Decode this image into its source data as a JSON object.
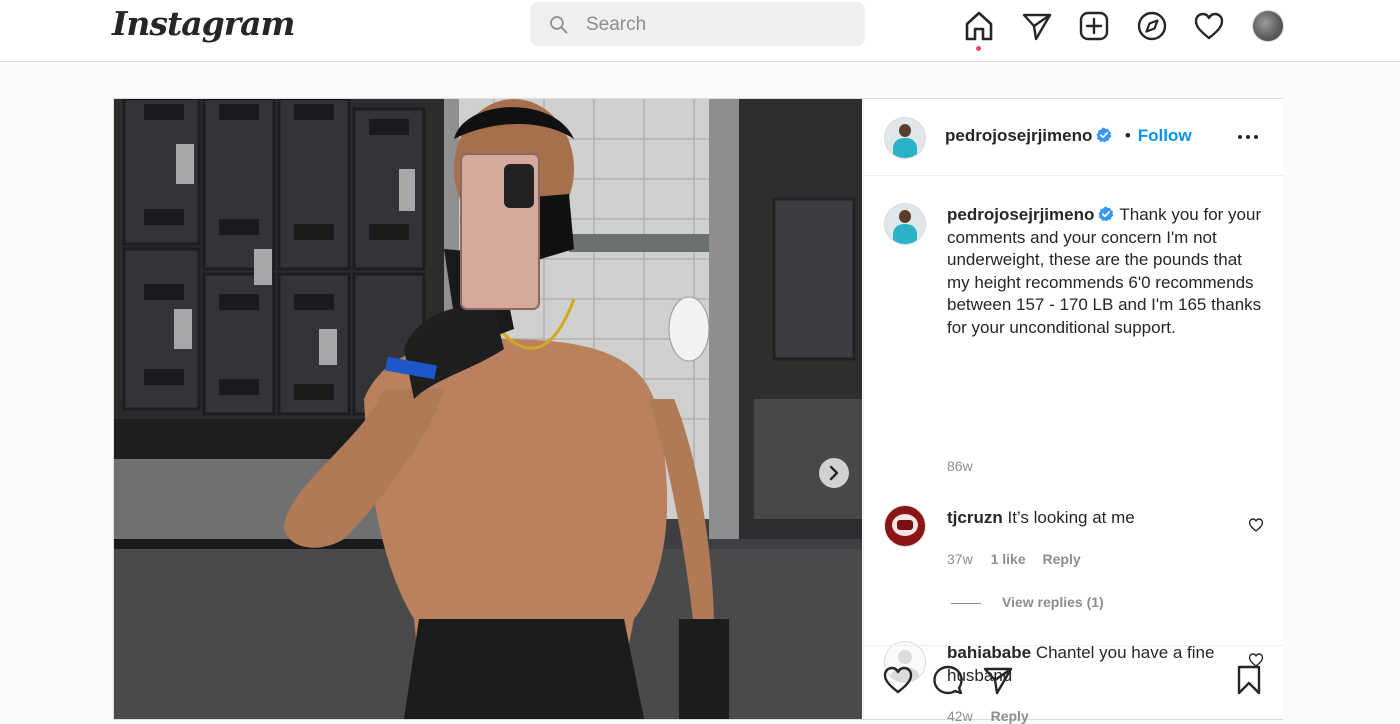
{
  "nav": {
    "logo": "Instagram",
    "search_placeholder": "Search"
  },
  "post": {
    "author": {
      "username": "pedrojosejrjimeno",
      "separator": "•",
      "follow_label": "Follow"
    },
    "caption": {
      "username": "pedrojosejrjimeno",
      "text": "Thank you for your comments and your concern I'm not underweight, these are the pounds that my height recommends 6'0 recommends between 157 - 170 LB and I'm 165 thanks for your unconditional support.",
      "time": "86w"
    },
    "comments": [
      {
        "username": "tjcruzn",
        "text": "It’s looking at me",
        "time": "37w",
        "likes": "1 like",
        "reply_label": "Reply",
        "view_replies": "View replies (1)"
      },
      {
        "username": "bahiababe",
        "text": "Chantel you have a fine husband",
        "time": "42w",
        "reply_label": "Reply"
      }
    ]
  },
  "colors": {
    "accent": "#0095f6",
    "verified": "#3897f0",
    "notification": "#ed4956",
    "text": "#262626",
    "muted": "#8e8e8e",
    "border": "#dbdbdb"
  },
  "icons": [
    "search-icon",
    "home-icon",
    "direct-icon",
    "new-post-icon",
    "explore-icon",
    "activity-heart-icon",
    "verified-icon",
    "more-icon",
    "like-icon",
    "comment-icon",
    "share-icon",
    "save-icon",
    "chevron-right-icon"
  ]
}
